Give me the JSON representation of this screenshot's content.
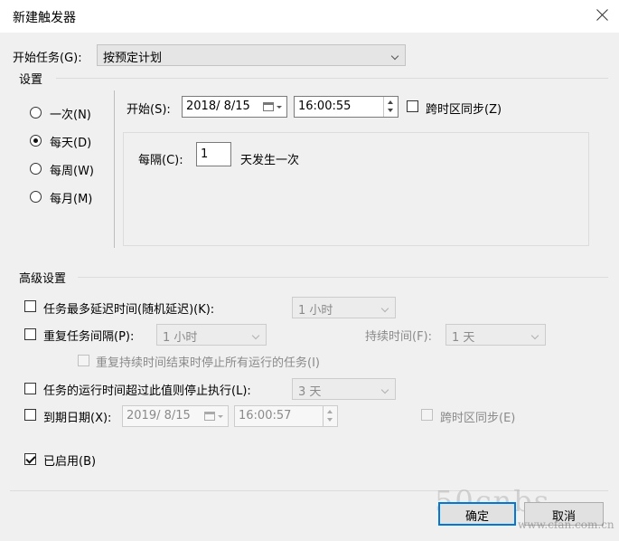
{
  "window": {
    "title": "新建触发器"
  },
  "start_task": {
    "label": "开始任务(G):",
    "value": "按预定计划"
  },
  "settings": {
    "heading": "设置",
    "radios": [
      {
        "label": "一次(N)",
        "checked": false
      },
      {
        "label": "每天(D)",
        "checked": true
      },
      {
        "label": "每周(W)",
        "checked": false
      },
      {
        "label": "每月(M)",
        "checked": false
      }
    ],
    "start_label": "开始(S):",
    "start_date": "2018/  8/15",
    "start_time": "16:00:55",
    "sync_timezone": "跨时区同步(Z)",
    "recur_label": "每隔(C):",
    "recur_value": "1",
    "recur_unit": "天发生一次"
  },
  "advanced": {
    "heading": "高级设置",
    "delay_label": "任务最多延迟时间(随机延迟)(K):",
    "delay_value": "1 小时",
    "repeat_label": "重复任务间隔(P):",
    "repeat_value": "1 小时",
    "duration_label": "持续时间(F):",
    "duration_value": "1 天",
    "stop_all_label": "重复持续时间结束时停止所有运行的任务(I)",
    "stop_if_label": "任务的运行时间超过此值则停止执行(L):",
    "stop_if_value": "3 天",
    "expire_label": "到期日期(X):",
    "expire_date": "2019/  8/15",
    "expire_time": "16:00:57",
    "expire_sync": "跨时区同步(E)",
    "enabled_label": "已启用(B)"
  },
  "buttons": {
    "ok": "确定",
    "cancel": "取消"
  },
  "watermark": {
    "logo": "50cnbs",
    "site": "www.cfan.com.cn"
  }
}
